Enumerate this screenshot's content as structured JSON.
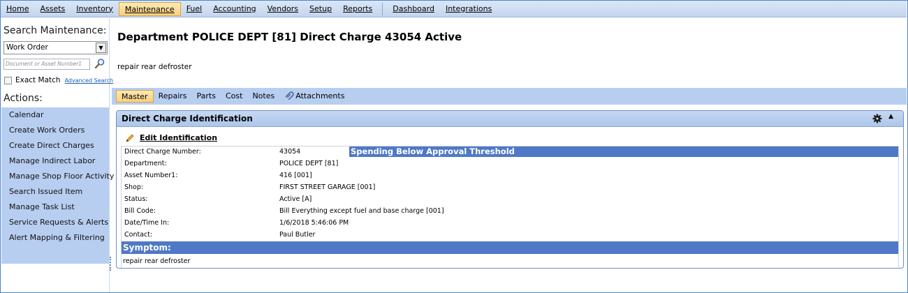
{
  "menu": {
    "items": [
      {
        "label": "Home",
        "active": false
      },
      {
        "label": "Assets",
        "active": false
      },
      {
        "label": "Inventory",
        "active": false
      },
      {
        "label": "Maintenance",
        "active": true
      },
      {
        "label": "Fuel",
        "active": false
      },
      {
        "label": "Accounting",
        "active": false
      },
      {
        "label": "Vendors",
        "active": false
      },
      {
        "label": "Setup",
        "active": false
      },
      {
        "label": "Reports",
        "active": false
      }
    ],
    "items_after_separator": [
      {
        "label": "Dashboard"
      },
      {
        "label": "Integrations"
      }
    ]
  },
  "sidebar": {
    "search_title": "Search Maintenance:",
    "search_type": "Work Order",
    "search_placeholder": "Document or Asset Number1",
    "exact_match_label": "Exact Match",
    "exact_match_checked": false,
    "advanced_search_label": "Advanced Search",
    "actions_title": "Actions:",
    "actions": [
      {
        "label": "Calendar"
      },
      {
        "label": "Create Work Orders"
      },
      {
        "label": "Create Direct Charges"
      },
      {
        "label": "Manage Indirect Labor"
      },
      {
        "label": "Manage Shop Floor Activity"
      },
      {
        "label": "Search Issued Item"
      },
      {
        "label": "Manage Task List"
      },
      {
        "label": "Service Requests & Alerts"
      },
      {
        "label": "Alert Mapping & Filtering"
      }
    ]
  },
  "header": {
    "title": "Department POLICE DEPT [81]  Direct Charge 43054  Active",
    "description": "repair rear defroster"
  },
  "tabs": [
    {
      "label": "Master",
      "active": true
    },
    {
      "label": "Repairs",
      "active": false
    },
    {
      "label": "Parts",
      "active": false
    },
    {
      "label": "Cost",
      "active": false
    },
    {
      "label": "Notes",
      "active": false
    },
    {
      "label": "Attachments",
      "active": false,
      "icon": "paperclip-icon"
    }
  ],
  "panel": {
    "title": "Direct Charge Identification",
    "edit_label": "Edit Identification",
    "threshold_banner": "Spending Below Approval Threshold",
    "fields": [
      {
        "label": "Direct Charge Number:",
        "value": "43054"
      },
      {
        "label": "Department:",
        "value": "POLICE DEPT [81]"
      },
      {
        "label": "Asset Number1:",
        "value": "416 [001]"
      },
      {
        "label": "Shop:",
        "value": "FIRST STREET GARAGE [001]"
      },
      {
        "label": "Status:",
        "value": "Active [A]"
      },
      {
        "label": "Bill Code:",
        "value": "Bill Everything except fuel and base charge [001]"
      },
      {
        "label": "Date/Time In:",
        "value": "1/6/2018 5:46:06 PM"
      },
      {
        "label": "Contact:",
        "value": "Paul Butler"
      }
    ],
    "symptom_label": "Symptom:",
    "symptom_text": "repair rear defroster"
  },
  "colors": {
    "menubar": "#c3d5ee",
    "active_tab": "#f8cf7e",
    "side_panel": "#b7cef0",
    "banner": "#4f79c6"
  }
}
